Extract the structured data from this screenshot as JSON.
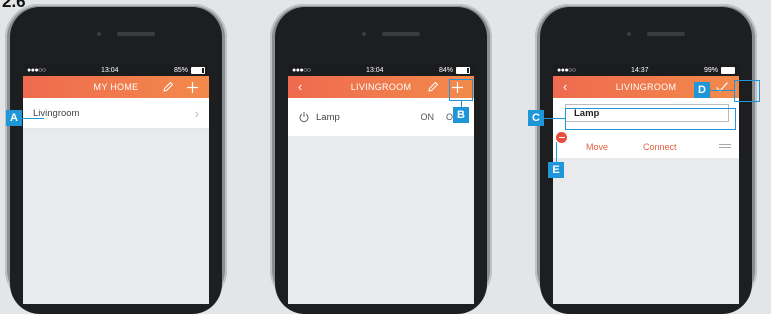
{
  "figure_label": "2.6",
  "phones": [
    {
      "status": {
        "signal": "●●●○○",
        "time": "13:04",
        "battery": "85%",
        "battery_fill": 0.85
      },
      "nav": {
        "title": "MY HOME",
        "edit_icon": "pencil-icon",
        "add_icon": "plus-icon"
      },
      "rows": [
        {
          "label": "Livingroom"
        }
      ]
    },
    {
      "status": {
        "signal": "●●●○○",
        "time": "13:04",
        "battery": "84%",
        "battery_fill": 0.84
      },
      "nav": {
        "title": "LIVINGROOM",
        "back_icon": "chevron-left-icon",
        "edit_icon": "pencil-icon",
        "add_icon": "plus-icon"
      },
      "device": {
        "name": "Lamp",
        "on": "ON",
        "off": "OFF",
        "icon": "power-icon"
      }
    },
    {
      "status": {
        "signal": "●●●○○",
        "time": "14:37",
        "battery": "99%",
        "battery_fill": 0.99
      },
      "nav": {
        "title": "LIVINGROOM",
        "back_icon": "chevron-left-icon",
        "confirm_icon": "checkmark-icon"
      },
      "edit": {
        "name_value": "Lamp",
        "move": "Move",
        "connect": "Connect",
        "delete_icon": "minus-circle-icon",
        "drag_icon": "drag-handle-icon"
      }
    }
  ],
  "callouts": {
    "A": "A",
    "B": "B",
    "C": "C",
    "D": "D",
    "E": "E"
  },
  "colors": {
    "accent_start": "#ef6a4f",
    "accent_end": "#f28a4b",
    "callout": "#1f96d8",
    "delete": "#e84e3c"
  }
}
